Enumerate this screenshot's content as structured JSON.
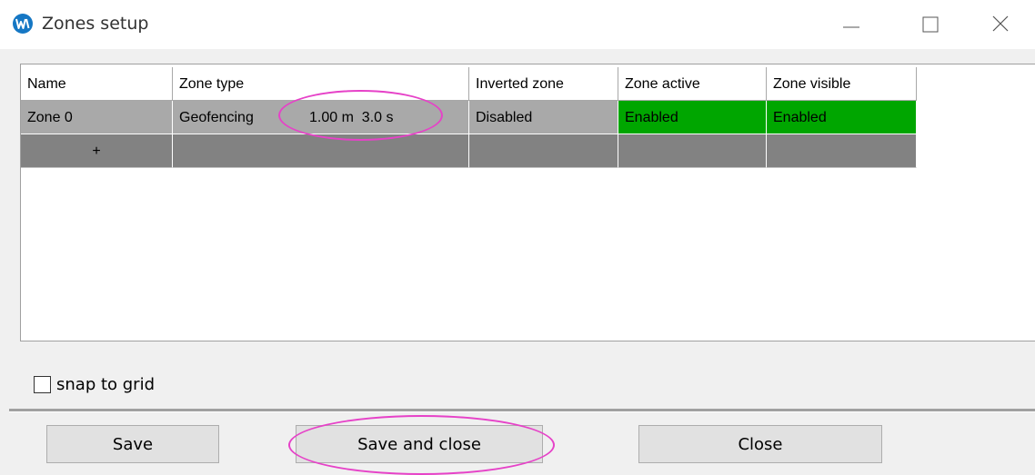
{
  "window": {
    "title": "Zones setup",
    "icon": "app-logo-icon",
    "controls": [
      "minimize-icon",
      "maximize-icon",
      "close-icon"
    ]
  },
  "table": {
    "columns": [
      "Name",
      "Zone type",
      "Inverted zone",
      "Zone active",
      "Zone visible"
    ],
    "rows": [
      {
        "name": "Zone 0",
        "zone_type": "Geofencing",
        "zone_params": "1.00 m  3.0 s",
        "inverted_zone": "Disabled",
        "zone_active": "Enabled",
        "zone_visible": "Enabled"
      }
    ],
    "add_row_label": "+"
  },
  "snap": {
    "label": "snap to grid",
    "checked": false
  },
  "buttons": {
    "save": "Save",
    "save_and_close": "Save and close",
    "close": "Close"
  },
  "colors": {
    "enabled_green": "#00a600",
    "row_gray": "#a9a9a9",
    "add_row_gray": "#828282",
    "annotation_magenta": "#e642c8",
    "logo_blue": "#1577c4"
  }
}
